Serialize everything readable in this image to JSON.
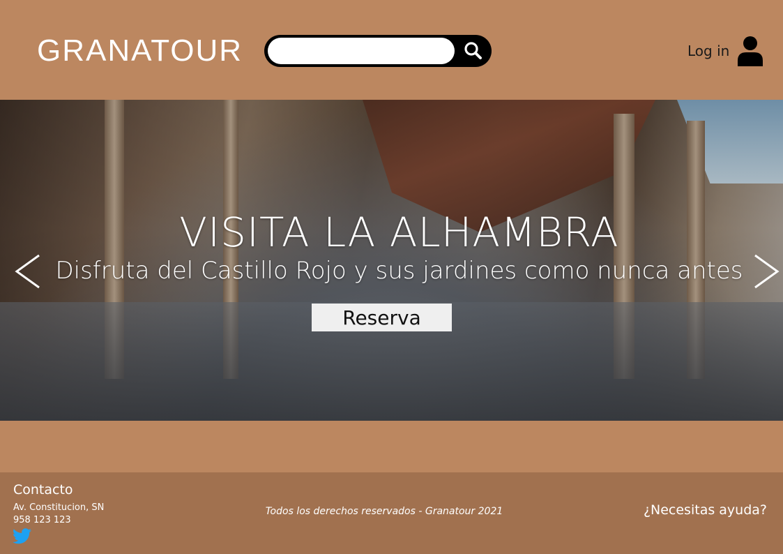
{
  "header": {
    "logo": "GRANATOUR",
    "search": {
      "value": "",
      "placeholder": ""
    },
    "login_label": "Log in"
  },
  "hero": {
    "title": "VISITA LA ALHAMBRA",
    "subtitle": "Disfruta del Castillo Rojo y sus jardines como nunca antes",
    "cta_label": "Reserva"
  },
  "footer": {
    "contact_title": "Contacto",
    "address": "Av. Constitucion, SN",
    "phone": "958 123 123",
    "copyright": "Todos los derechos reservados - Granatour 2021",
    "help": "¿Necesitas ayuda?"
  },
  "colors": {
    "page_background": "#bc8760",
    "footer_background": "#a1714f",
    "twitter": "#1da1f2"
  },
  "icons": [
    "search-icon",
    "user-icon",
    "chevron-left-icon",
    "chevron-right-icon",
    "twitter-icon"
  ]
}
